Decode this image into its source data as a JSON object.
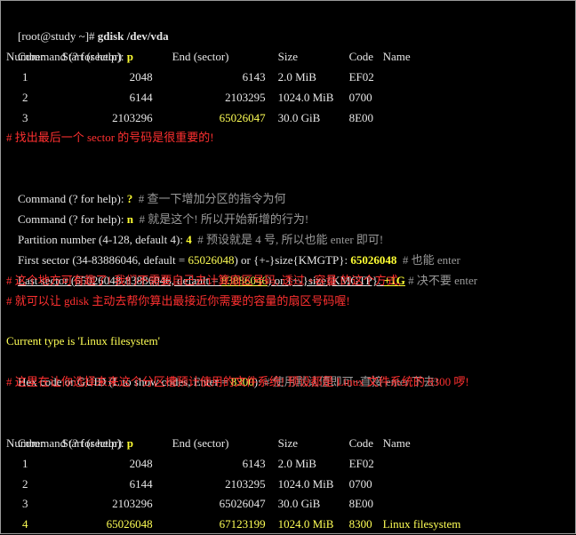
{
  "cmd1": {
    "prompt": "[root@study ~]# ",
    "command": "gdisk /dev/vda"
  },
  "cmd2": {
    "prompt": "Command (? for help): ",
    "input": "p"
  },
  "table1": {
    "headers": [
      "Number",
      "Start (sector)",
      "End (sector)",
      "Size",
      "Code",
      "Name"
    ],
    "rows": [
      {
        "num": "1",
        "start": "2048",
        "end": "6143",
        "size": "2.0 MiB",
        "code": "EF02",
        "name": ""
      },
      {
        "num": "2",
        "start": "6144",
        "end": "2103295",
        "size": "1024.0 MiB",
        "code": "0700",
        "name": ""
      },
      {
        "num": "3",
        "start": "2103296",
        "end": "65026047",
        "size": "30.0 GiB",
        "code": "8E00",
        "name": ""
      }
    ]
  },
  "comment1": "# 找出最后一个 sector 的号码是很重要的!",
  "cmd3": {
    "prompt": "Command (? for help): ",
    "input": "?",
    "comment": "  # 查一下增加分区的指令为何"
  },
  "cmd4": {
    "prompt": "Command (? for help): ",
    "input": "n",
    "comment": "  # 就是这个! 所以开始新增的行为!"
  },
  "partnum": {
    "text": "Partition number (4-128, default 4): ",
    "input": "4",
    "comment": "  # 预设就是 4 号, 所以也能 enter 即可!"
  },
  "first": {
    "pre": "First sector (34-83886046, default = ",
    "default": "65026048",
    "post": ") or {+-}size{KMGTP}: ",
    "input": "65026048",
    "comment": "  # 也能 enter"
  },
  "last": {
    "pre": "Last sector (65026048-83886046, default = ",
    "default": "83886046",
    "post": ") or {+-}size{KMGTP}: ",
    "input": "+1G",
    "comment": " # 决不要 enter"
  },
  "comment2": "# 这个地方可有趣了! 我们不需要自己去计算扇区号码, 透过 +容量 的这个方式,",
  "comment3": "# 就可以让 gdisk 主动去帮你算出最接近你需要的容量的扇区号码喔!",
  "curtype": {
    "text": "Current type is 'Linux filesystem'"
  },
  "hexcode": {
    "pre": "Hex code or GUID (L to show codes, Enter = ",
    "default": "8300",
    "post": "): ",
    "comment": "# 使用默认值即可~直接 enter 下去!"
  },
  "comment4": "# 这里在让你选择未来这个分区槽预计使用的文件系统! 预设都是 Linux 文件系统的 8300 啰!",
  "cmd5": {
    "prompt": "Command (? for help): ",
    "input": "p"
  },
  "table2": {
    "headers": [
      "Number",
      "Start (sector)",
      "End (sector)",
      "Size",
      "Code",
      "Name"
    ],
    "rows": [
      {
        "num": "1",
        "start": "2048",
        "end": "6143",
        "size": "2.0 MiB",
        "code": "EF02",
        "name": ""
      },
      {
        "num": "2",
        "start": "6144",
        "end": "2103295",
        "size": "1024.0 MiB",
        "code": "0700",
        "name": ""
      },
      {
        "num": "3",
        "start": "2103296",
        "end": "65026047",
        "size": "30.0 GiB",
        "code": "8E00",
        "name": ""
      },
      {
        "num": "4",
        "start": "65026048",
        "end": "67123199",
        "size": "1024.0 MiB",
        "code": "8300",
        "name": "Linux filesystem"
      }
    ]
  },
  "colors": {
    "background": "#000000",
    "text": "#e6e6e6",
    "highlight": "#ffff33",
    "comment_red": "#ff3030",
    "comment_gray": "#9a9a9a"
  }
}
